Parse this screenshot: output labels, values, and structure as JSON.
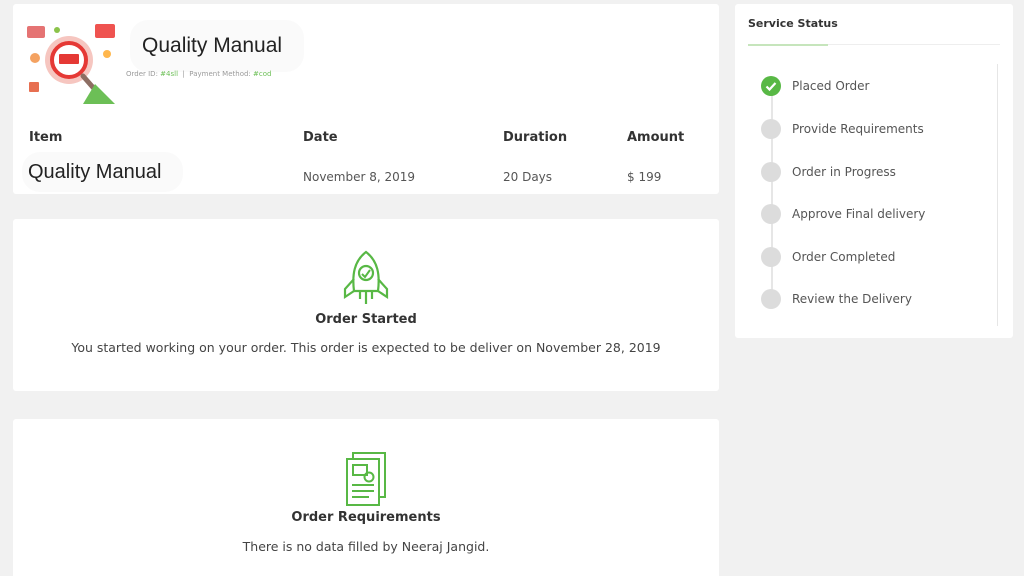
{
  "order": {
    "title": "Quality Manual",
    "meta": {
      "order_id_label": "Order ID:",
      "order_id": "#4sll",
      "separator": "|",
      "payment_label": "Payment Method:",
      "payment": "#cod"
    },
    "table": {
      "headers": {
        "item": "Item",
        "date": "Date",
        "duration": "Duration",
        "amount": "Amount"
      },
      "row": {
        "item": "Quality Manual",
        "date": "November 8, 2019",
        "duration": "20 Days",
        "amount": "$ 199"
      }
    }
  },
  "started": {
    "icon": "rocket-icon",
    "title": "Order Started",
    "text": "You started working on your order. This order is expected to be deliver on November 28, 2019"
  },
  "requirements": {
    "icon": "document-icon",
    "title": "Order Requirements",
    "text": "There is no data filled by Neeraj Jangid."
  },
  "status": {
    "title": "Service Status",
    "steps": [
      {
        "label": "Placed Order",
        "done": true
      },
      {
        "label": "Provide Requirements",
        "done": false
      },
      {
        "label": "Order in Progress",
        "done": false
      },
      {
        "label": "Approve Final delivery",
        "done": false
      },
      {
        "label": "Order Completed",
        "done": false
      },
      {
        "label": "Review the Delivery",
        "done": false
      }
    ]
  },
  "colors": {
    "accent": "#58b845",
    "pending": "#dcdcdc",
    "background": "#f1f1f1"
  }
}
